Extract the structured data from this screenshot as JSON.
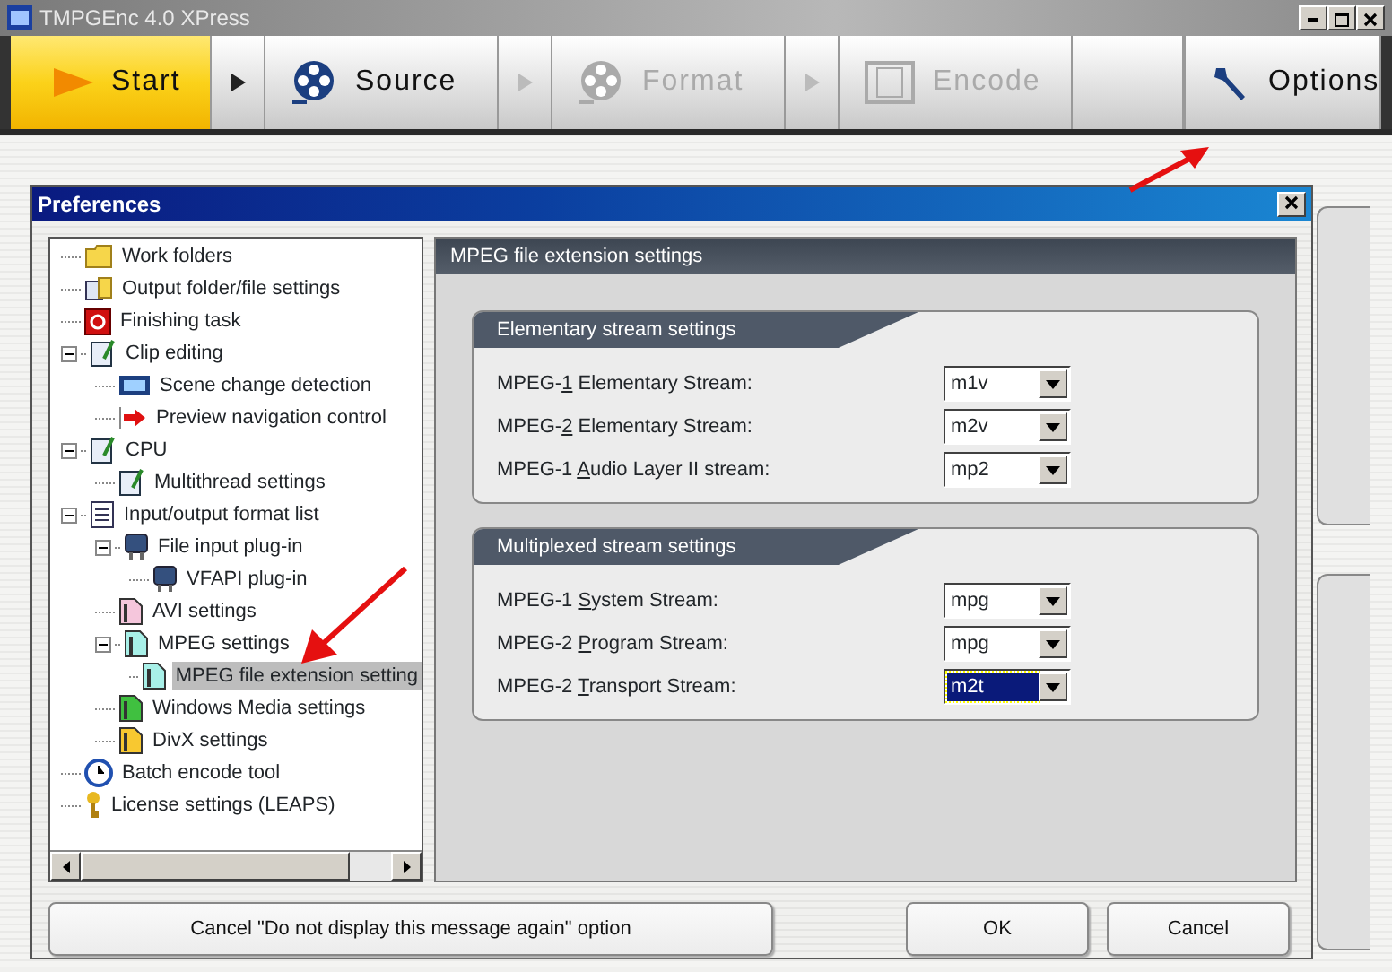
{
  "window": {
    "title": "TMPGEnc 4.0 XPress"
  },
  "steps": [
    {
      "label": "Start",
      "kind": "play",
      "selected": true,
      "disabled": false
    },
    {
      "label": "Source",
      "kind": "reel",
      "selected": false,
      "disabled": false
    },
    {
      "label": "Format",
      "kind": "reel",
      "selected": false,
      "disabled": true
    },
    {
      "label": "Encode",
      "kind": "film",
      "selected": false,
      "disabled": true
    }
  ],
  "options_button": {
    "label": "Options"
  },
  "dialog": {
    "title": "Preferences",
    "tree": [
      {
        "label": "Work folders",
        "kind": "folder",
        "selected": false
      },
      {
        "label": "Output folder/file settings",
        "kind": "folderfile",
        "selected": false
      },
      {
        "label": "Finishing task",
        "kind": "stop",
        "selected": false
      },
      {
        "label": "Clip editing",
        "kind": "note",
        "selected": false,
        "expanded": true,
        "children": [
          {
            "label": "Scene change detection",
            "kind": "film",
            "selected": false
          },
          {
            "label": "Preview navigation control",
            "kind": "redarrow",
            "selected": false
          }
        ]
      },
      {
        "label": "CPU",
        "kind": "note",
        "selected": false,
        "expanded": true,
        "children": [
          {
            "label": "Multithread settings",
            "kind": "note",
            "selected": false
          }
        ]
      },
      {
        "label": "Input/output format list",
        "kind": "list",
        "selected": false,
        "expanded": true,
        "children": [
          {
            "label": "File input plug-in",
            "kind": "plug",
            "selected": false,
            "expanded": true,
            "children": [
              {
                "label": "VFAPI plug-in",
                "kind": "plug",
                "selected": false
              }
            ]
          },
          {
            "label": "AVI settings",
            "kind": "filepink",
            "selected": false
          },
          {
            "label": "MPEG settings",
            "kind": "filecyan",
            "selected": false,
            "expanded": true,
            "children": [
              {
                "label": "MPEG file extension setting",
                "kind": "filecyan",
                "selected": true
              }
            ]
          },
          {
            "label": "Windows Media settings",
            "kind": "filegreen",
            "selected": false
          },
          {
            "label": "DivX settings",
            "kind": "fileyellow",
            "selected": false
          }
        ]
      },
      {
        "label": "Batch encode tool",
        "kind": "clock",
        "selected": false
      },
      {
        "label": "License settings (LEAPS)",
        "kind": "key",
        "selected": false
      }
    ],
    "panel_title": "MPEG file extension settings",
    "groups": [
      {
        "title": "Elementary stream settings",
        "fields": [
          {
            "label": {
              "before": "MPEG-",
              "key": "1",
              "after": " Elementary Stream:"
            },
            "value": "m1v",
            "focused": false
          },
          {
            "label": {
              "before": "MPEG-",
              "key": "2",
              "after": " Elementary Stream:"
            },
            "value": "m2v",
            "focused": false
          },
          {
            "label": {
              "before": "MPEG-1 ",
              "key": "A",
              "after": "udio Layer II stream:"
            },
            "value": "mp2",
            "focused": false
          }
        ]
      },
      {
        "title": "Multiplexed stream settings",
        "fields": [
          {
            "label": {
              "before": "MPEG-1 ",
              "key": "S",
              "after": "ystem Stream:"
            },
            "value": "mpg",
            "focused": false
          },
          {
            "label": {
              "before": "MPEG-2 ",
              "key": "P",
              "after": "rogram Stream:"
            },
            "value": "mpg",
            "focused": false
          },
          {
            "label": {
              "before": "MPEG-2 ",
              "key": "T",
              "after": "ransport Stream:"
            },
            "value": "m2t",
            "focused": true
          }
        ]
      }
    ],
    "buttons": [
      "Cancel \"Do not display this message again\" option",
      "OK",
      "Cancel"
    ]
  }
}
